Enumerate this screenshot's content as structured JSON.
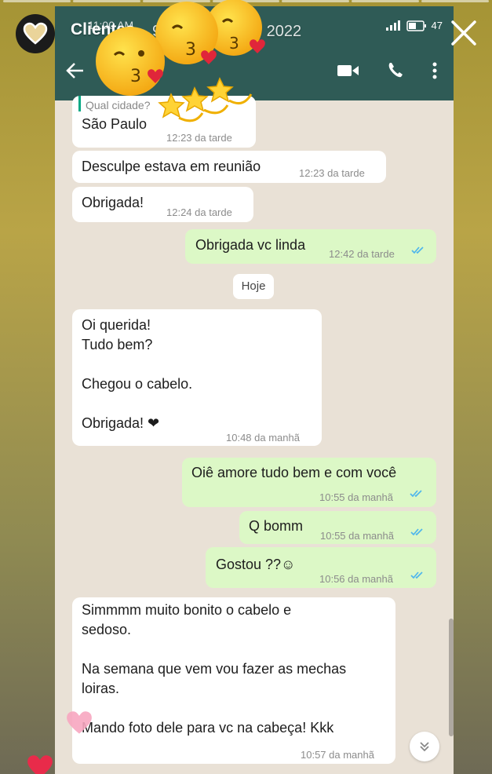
{
  "story": {
    "title": "Clientes",
    "date": "9 de outubro de 2022",
    "progress_segments": 7
  },
  "status_bar": {
    "time": "11:00 AM",
    "battery": "47"
  },
  "chat": {
    "quoted_text": "Qual cidade?",
    "messages": [
      {
        "dir": "in",
        "text": "São Paulo",
        "time": "12:23 da tarde"
      },
      {
        "dir": "in",
        "text": "Desculpe estava em reunião",
        "time": "12:23 da tarde"
      },
      {
        "dir": "in",
        "text": "Obrigada!",
        "time": "12:24 da tarde"
      },
      {
        "dir": "out",
        "text": "Obrigada vc linda",
        "time": "12:42 da tarde"
      },
      {
        "dir": "in",
        "text": "Oi querida!\nTudo bem?\n\nChegou o cabelo.\n\nObrigada! ❤",
        "time": "10:48 da manhã"
      },
      {
        "dir": "out",
        "text": "Oiê amore tudo bem e com você",
        "time": "10:55 da manhã"
      },
      {
        "dir": "out",
        "text": "Q bomm",
        "time": "10:55 da manhã"
      },
      {
        "dir": "out",
        "text": "Gostou ??☺",
        "time": "10:56 da manhã"
      },
      {
        "dir": "in",
        "text": "Simmmm muito bonito o cabelo e\nsedoso.\n\nNa semana que vem vou fazer as mechas\nloiras.\n\nMando foto dele para vc na cabeça! Kkk",
        "time": "10:57 da manhã"
      }
    ],
    "date_chip": "Hoje"
  },
  "colors": {
    "header_bg": "#2f5b56",
    "incoming": "#ffffff",
    "outgoing": "#dcf8c6",
    "ticks": "#4fb6ec"
  }
}
